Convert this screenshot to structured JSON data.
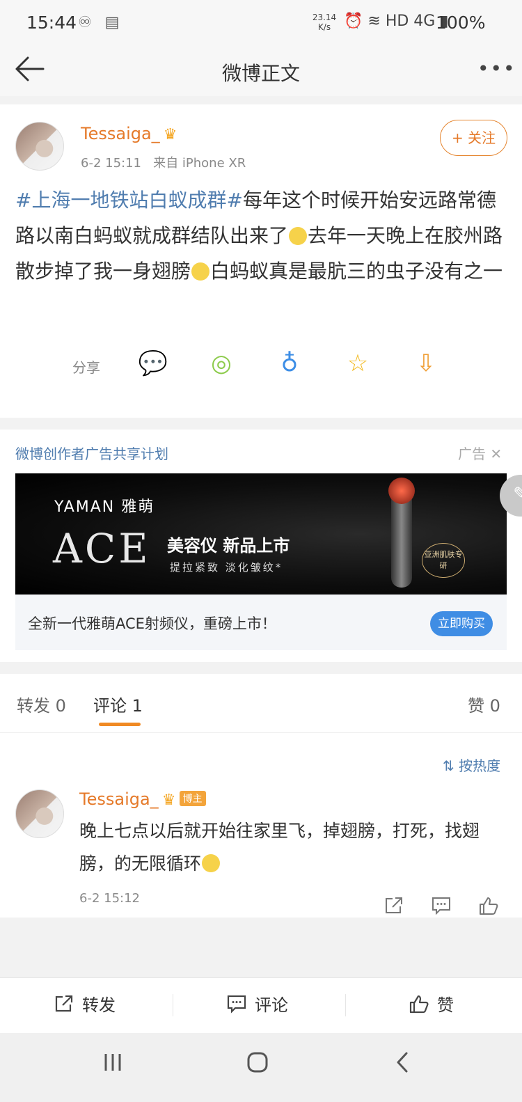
{
  "status_bar": {
    "time": "15:44",
    "left_icons": "♾ ▤",
    "net_speed_value": "23.14",
    "net_speed_unit": "K/s",
    "right_icons": "⏰ ≋ HD 4G ▮",
    "battery": "100%"
  },
  "nav": {
    "title": "微博正文",
    "more": "•••"
  },
  "post": {
    "username": "Tessaiga_",
    "crown": "♛",
    "time": "6-2 15:11",
    "source": "来自 iPhone XR",
    "follow_label": "+ 关注",
    "hashtag": "#上海一地铁站白蚁成群#",
    "text_1": "每年这个时候开始安远路常德路以南白蚂蚁就成群结队出来了",
    "text_2": "去年一天晚上在胶州路散步掉了我一身翅膀",
    "text_3": "白蚂蚁真是最肮三的虫子没有之一"
  },
  "share": {
    "label": "分享",
    "icons": [
      "wechat-icon",
      "moments-icon",
      "qq-icon",
      "qzone-icon",
      "save-image-icon"
    ],
    "glyphs": [
      "💬",
      "◎",
      "♁",
      "☆",
      "⇩"
    ]
  },
  "ad": {
    "title": "微博创作者广告共享计划",
    "tag": "广告 ✕",
    "brand": "YAMAN 雅萌",
    "product": "ACE",
    "headline": "美容仪 新品上市",
    "subline": "提拉紧致  淡化皱纹*",
    "badge": "亚洲肌肤专研",
    "caption": "全新一代雅萌ACE射频仪，重磅上市！",
    "cta": "立即购买"
  },
  "tabs": [
    {
      "label": "转发",
      "count": "0"
    },
    {
      "label": "评论",
      "count": "1"
    },
    {
      "label": "赞",
      "count": "0"
    }
  ],
  "sort_label": "按热度",
  "comment": {
    "username": "Tessaiga_",
    "crown": "♛",
    "badge": "博主",
    "text": "晚上七点以后就开始往家里飞，掉翅膀，打死，找翅膀，的无限循环",
    "time": "6-2 15:12"
  },
  "bottom_bar": {
    "repost": "转发",
    "comment": "评论",
    "like": "赞"
  },
  "colors": {
    "accent": "#e57a2a",
    "link": "#507daf",
    "tab_indicator": "#f08a24",
    "cta": "#3f8de4"
  }
}
